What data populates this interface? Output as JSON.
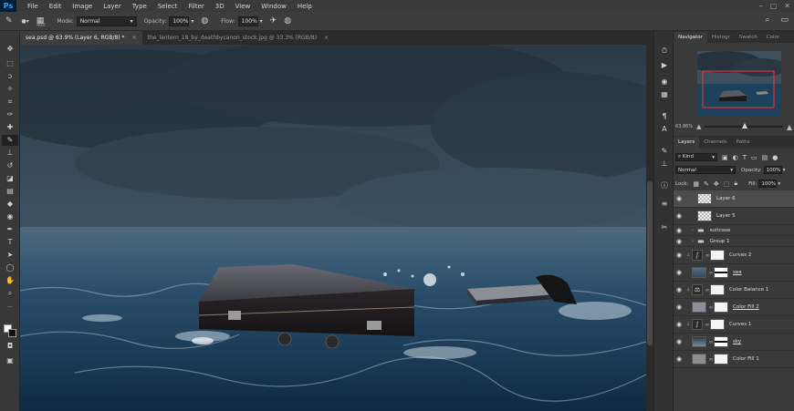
{
  "app": {
    "logo": "Ps"
  },
  "menu": [
    "File",
    "Edit",
    "Image",
    "Layer",
    "Type",
    "Select",
    "Filter",
    "3D",
    "View",
    "Window",
    "Help"
  ],
  "window_controls": [
    "–",
    "▢",
    "✕"
  ],
  "options": {
    "brush_size": "400",
    "mode_label": "Mode:",
    "mode_value": "Normal",
    "opacity_label": "Opacity:",
    "opacity_value": "100%",
    "flow_label": "Flow:",
    "flow_value": "100%"
  },
  "tabs": [
    {
      "label": "sea.psd @ 63.9% (Layer 6, RGB/8) *",
      "close": "×",
      "active": true
    },
    {
      "label": "the_lantern_18_by_deathbycanon_stock.jpg @ 33.3% (RGB/8)",
      "close": "×",
      "active": false
    }
  ],
  "panels": {
    "top_tabs": [
      "Navigator",
      "Histogr",
      "Swatch",
      "Color"
    ],
    "zoom": "63.86%",
    "layer_tabs": [
      "Layers",
      "Channels",
      "Paths"
    ],
    "filter_kind": "Kind",
    "blend_mode": "Normal",
    "opacity_label": "Opacity:",
    "opacity_value": "100%",
    "lock_label": "Lock:",
    "fill_label": "Fill:",
    "fill_value": "100%"
  },
  "layers": [
    {
      "name": "Layer 6",
      "selected": true
    },
    {
      "name": "Layer 5",
      "selected": false
    },
    {
      "name": "suitcase",
      "selected": false
    },
    {
      "name": "Group 1",
      "selected": false
    },
    {
      "name": "Curves 2",
      "selected": false
    },
    {
      "name": "sea",
      "selected": false
    },
    {
      "name": "Color Balance 1",
      "selected": false
    },
    {
      "name": "Color Fill 2",
      "selected": false
    },
    {
      "name": "Curves 1",
      "selected": false
    },
    {
      "name": "sky",
      "selected": false
    },
    {
      "name": "Color Fill 1",
      "selected": false
    }
  ],
  "colors": {
    "accent": "#31a8ff",
    "ui_dark": "#262626",
    "ui_panel": "#3a3a3a",
    "nav_frame": "#ff3030"
  }
}
